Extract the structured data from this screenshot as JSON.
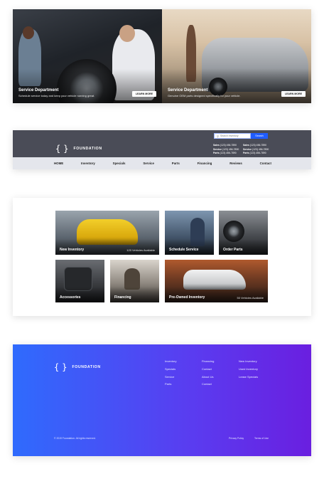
{
  "hero": {
    "tiles": [
      {
        "title": "Service Department",
        "description": "Schedule service today and keep your vehicle running great.",
        "button": "LEARN MORE"
      },
      {
        "title": "Service Department",
        "description": "Genuine OEM parts designed specifically for your vehicle.",
        "button": "LEARN MORE"
      }
    ]
  },
  "header": {
    "brand": "FOUNDATION",
    "brace_open": "{",
    "brace_close": "}",
    "search_placeholder": "Search Inventory",
    "search_button": "Search",
    "contacts_left": [
      {
        "label": "Sales",
        "phone": "(123) 456-7890"
      },
      {
        "label": "Service",
        "phone": "(123) 456-7890"
      },
      {
        "label": "Parts",
        "phone": "(123) 456-7890"
      }
    ],
    "contacts_right": [
      {
        "label": "Sales",
        "phone": "(123) 456-7890"
      },
      {
        "label": "Service",
        "phone": "(123) 456-7890"
      },
      {
        "label": "Parts",
        "phone": "(123) 456-7890"
      }
    ],
    "nav": [
      "HOME",
      "Inventory",
      "Specials",
      "Service",
      "Parts",
      "Financing",
      "Reviews",
      "Contact"
    ]
  },
  "tiles": {
    "new_inventory": {
      "label": "New Inventory",
      "count": "120 Vehicles Available"
    },
    "schedule_service": {
      "label": "Schedule Service"
    },
    "order_parts": {
      "label": "Order Parts"
    },
    "accessories": {
      "label": "Accessories"
    },
    "financing": {
      "label": "Financing"
    },
    "pre_owned": {
      "label": "Pre-Owned Inventory",
      "count": "50 Vehicles Available"
    }
  },
  "footer": {
    "brand": "FOUNDATION",
    "col1": [
      "Inventory",
      "Specials",
      "Service",
      "Parts"
    ],
    "col2": [
      "Financing",
      "Contact",
      "About Us",
      "Contact"
    ],
    "col3": [
      "New Inventory",
      "Used Inventory",
      "Lease Specials"
    ],
    "copyright": "© 2019 Foundation. All rights reserved.",
    "privacy": "Privacy Policy",
    "terms": "Terms of Use"
  },
  "colors": {
    "header_bar": "#4a4c57",
    "nav_bar": "#e4e6ec",
    "search_button": "#1f5cff",
    "footer_gradient_start": "#2f6bfd",
    "footer_gradient_end": "#6a1fe0"
  },
  "icons": {
    "search": "magnifier-icon",
    "logo": "curly-brace-logo-icon"
  }
}
